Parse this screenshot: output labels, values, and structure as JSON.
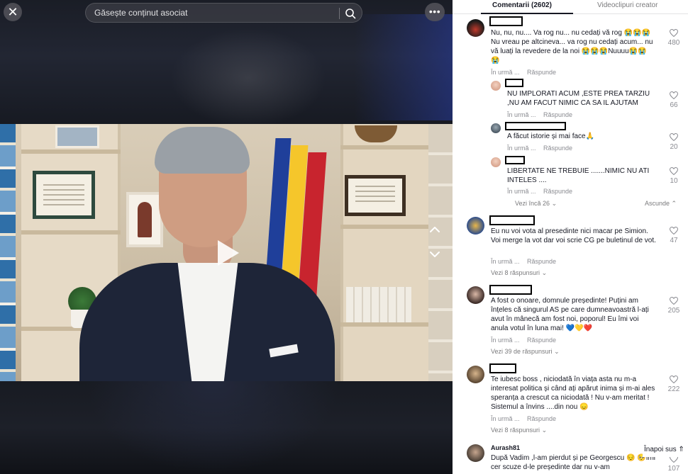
{
  "search": {
    "placeholder": "Găsește conținut asociat"
  },
  "top": {
    "close_glyph": "✕",
    "more_glyph": "•••"
  },
  "tabs": [
    {
      "label": "Comentarii (2602)",
      "active": true
    },
    {
      "label": "Videoclipuri creator",
      "active": false
    }
  ],
  "comments": [
    {
      "text": "Nu, nu, nu.... Va rog nu... nu cedați vă rog 😭😭😭 Nu vreau pe altcineva... va rog nu cedați acum... nu vă luați la revedere de la noi 😭😭😭Nuuuu😭😭 😭",
      "time": "În urmă ...",
      "reply": "Răspunde",
      "likes": "480",
      "replies": [
        {
          "text": "NU IMPLORATI ACUM ,ESTE PREA TARZIU ,NU AM FACUT NIMIC CA SA IL AJUTAM",
          "time": "În urmă ...",
          "reply": "Răspunde",
          "likes": "66"
        },
        {
          "text": "A făcut istorie și mai face🙏",
          "time": "În urmă ...",
          "reply": "Răspunde",
          "likes": "20"
        },
        {
          "text": "LIBERTATE NE TREBUIE .......NIMIC NU ATI INTELES ....",
          "time": "În urmă ...",
          "reply": "Răspunde",
          "likes": "10"
        }
      ],
      "more": "Vezi încă 26",
      "hide": "Ascunde"
    },
    {
      "text": "Eu nu voi vota al presedinte nici macar pe Simion. Voi merge la vot dar voi scrie CG pe buletinul de vot.",
      "time": "În urmă ...",
      "reply": "Răspunde",
      "likes": "47",
      "more": "Vezi 8 răspunsuri"
    },
    {
      "text": "A fost o onoare, domnule președinte! Puțini am înțeles că singurul AS pe care dumneavoastră l-ați avut în mânecă am fost noi, poporul! Eu îmi voi anula votul în luna mai! 💙💛❤️",
      "time": "În urmă ...",
      "reply": "Răspunde",
      "likes": "205",
      "more": "Vezi 39 de răspunsuri"
    },
    {
      "text": "Te iubesc boss , niciodată în viața asta nu m-a interesat politica și când ați apărut inima și m-ai ales speranța a crescut ca niciodată ! Nu v-am meritat ! Sistemul a învins ....din nou 😞",
      "time": "În urmă ...",
      "reply": "Răspunde",
      "likes": "222",
      "more": "Vezi 8 răspunsuri"
    },
    {
      "username": "Aurash81",
      "text": "După Vadim ,l-am pierdut și pe Georgescu 😔 🥺Îmi cer scuze d-le președinte dar nu v-am",
      "likes": "107"
    }
  ],
  "back_to_top": "Înapoi sus"
}
